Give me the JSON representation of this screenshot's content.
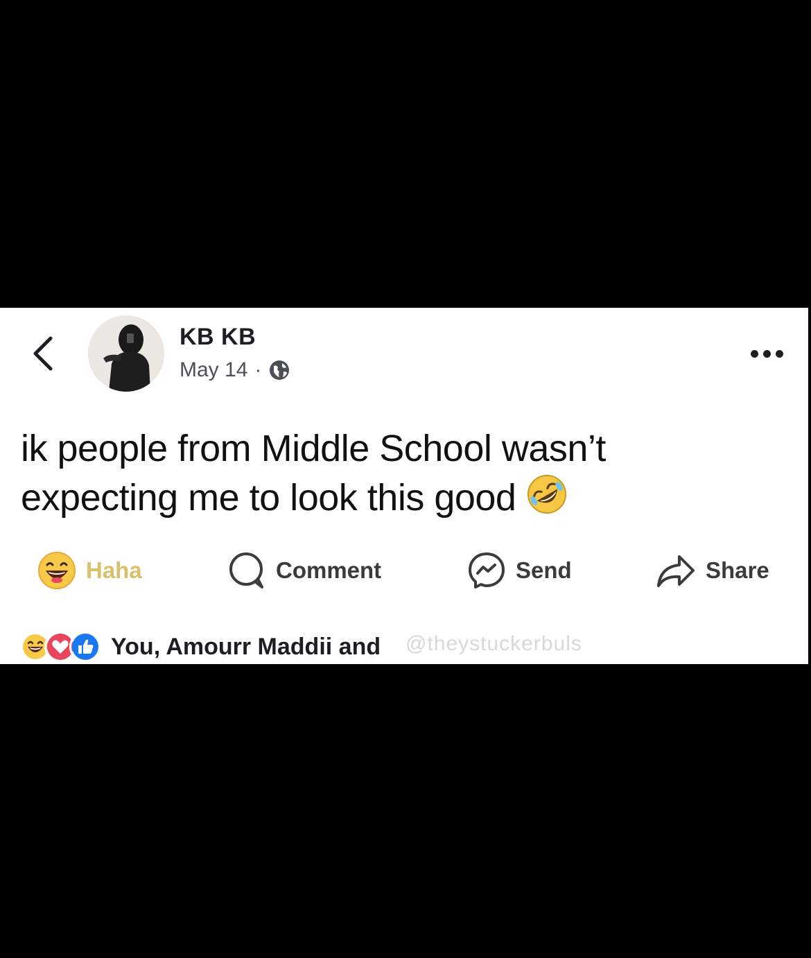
{
  "post": {
    "author": "KB KB",
    "date": "May 14",
    "separator": "·",
    "privacy_icon": "globe-icon",
    "text_line1": "ik people from Middle School wasn’t",
    "text_line2": "expecting me to look this good"
  },
  "actions": {
    "haha": "Haha",
    "comment": "Comment",
    "send": "Send",
    "share": "Share"
  },
  "reactions": {
    "summary": "You, Amourr Maddii and",
    "icons": [
      "haha-icon",
      "love-icon",
      "like-icon"
    ]
  },
  "watermark": "@theystuckerbuls",
  "colors": {
    "haha_label": "#d9c06a",
    "love": "#e8465f",
    "like": "#1877f2"
  }
}
